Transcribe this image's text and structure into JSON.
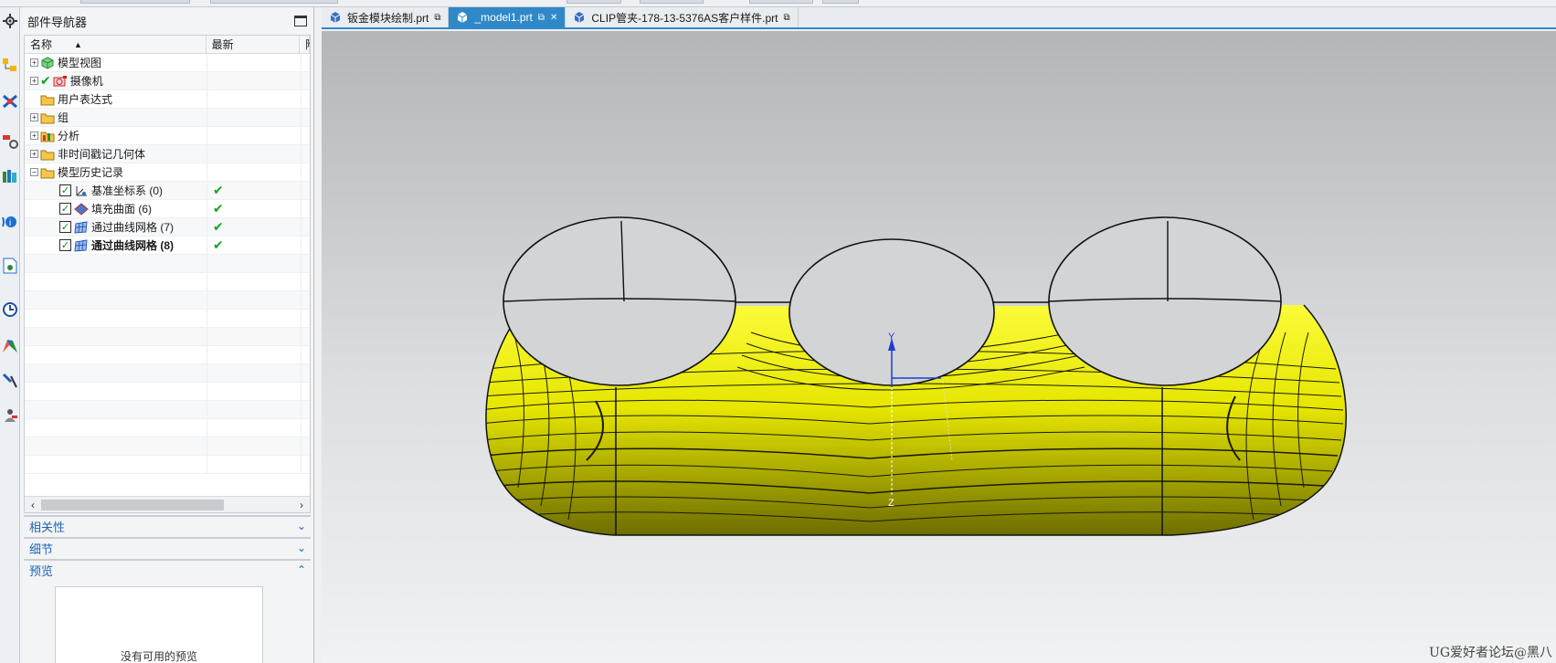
{
  "navigator": {
    "title": "部件导航器",
    "columns": [
      "名称",
      "最新",
      "附"
    ],
    "items": [
      {
        "label": "模型视图",
        "expander": "+",
        "icon": "model-views-icon"
      },
      {
        "label": "摄像机",
        "expander": "+",
        "icon": "camera-icon"
      },
      {
        "label": "用户表达式",
        "expander": "",
        "icon": "folder-icon"
      },
      {
        "label": "组",
        "expander": "+",
        "icon": "folder-icon"
      },
      {
        "label": "分析",
        "expander": "+",
        "icon": "analysis-icon"
      },
      {
        "label": "非时间戳记几何体",
        "expander": "+",
        "icon": "folder-icon"
      },
      {
        "label": "模型历史记录",
        "expander": "−",
        "icon": "folder-icon"
      },
      {
        "label": "基准坐标系 (0)",
        "icon": "datum-csys-icon",
        "latest": "✔"
      },
      {
        "label": "填充曲面 (6)",
        "icon": "fill-surface-icon",
        "latest": "✔"
      },
      {
        "label": "通过曲线网格 (7)",
        "icon": "through-curve-mesh-icon",
        "latest": "✔"
      },
      {
        "label": "通过曲线网格 (8)",
        "icon": "through-curve-mesh-icon",
        "latest": "✔"
      }
    ],
    "groups": {
      "dependencies": "相关性",
      "details": "细节",
      "preview": "预览",
      "preview_empty": "没有可用的预览"
    }
  },
  "tabs": [
    {
      "label": "钣金模块绘制.prt",
      "active": false
    },
    {
      "label": "_model1.prt",
      "active": true
    },
    {
      "label": "CLIP管夹-178-13-5376AS客户样件.prt",
      "active": false
    }
  ],
  "viewport": {
    "axis_y": "Y",
    "axis_z": "Z",
    "watermark": "UG爱好者论坛@黑八",
    "surface_color": "#e6e600",
    "background_top": "#b5b8bb",
    "background_bottom": "#f0f1f2"
  }
}
